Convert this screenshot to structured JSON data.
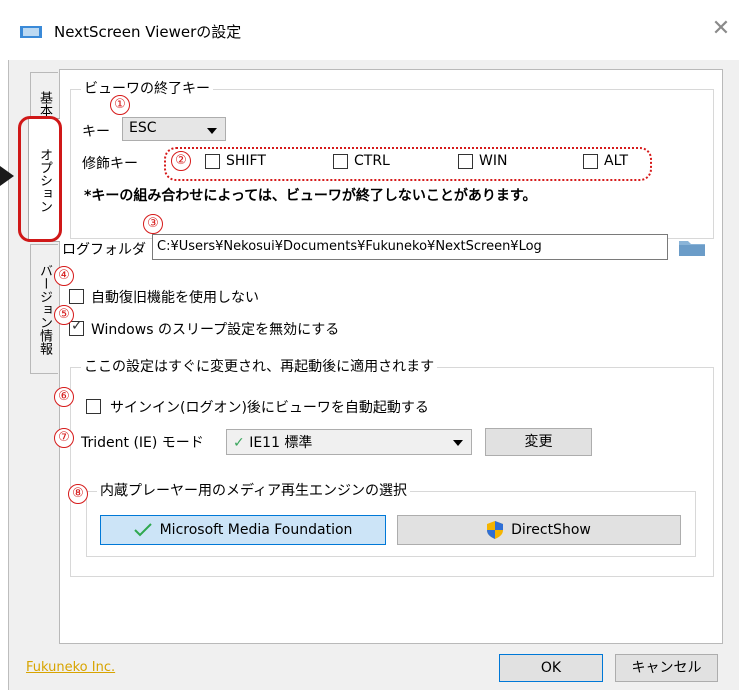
{
  "window": {
    "title": "NextScreen Viewerの設定",
    "close_glyph": "✕"
  },
  "tabs": [
    {
      "label": "基本"
    },
    {
      "label": "オプション"
    },
    {
      "label": "バージョン情報"
    }
  ],
  "markers": [
    "①",
    "②",
    "③",
    "④",
    "⑤",
    "⑥",
    "⑦",
    "⑧"
  ],
  "exit_key": {
    "legend": "ビューワの終了キー",
    "key_label": "キー",
    "key_value": "ESC",
    "modifier_label": "修飾キー",
    "modifiers": [
      {
        "label": "SHIFT",
        "checked": false
      },
      {
        "label": "CTRL",
        "checked": false
      },
      {
        "label": "WIN",
        "checked": false
      },
      {
        "label": "ALT",
        "checked": false
      }
    ],
    "warning": "*キーの組み合わせによっては、ビューワが終了しないことがあります。"
  },
  "log": {
    "label": "ログフォルダ",
    "path": "C:¥Users¥Nekosui¥Documents¥Fukuneko¥NextScreen¥Log"
  },
  "auto_recovery": {
    "label": "自動復旧機能を使用しない",
    "checked": false
  },
  "sleep": {
    "label": "Windows のスリープ設定を無効にする",
    "checked": true
  },
  "restart_group": {
    "legend": "ここの設定はすぐに変更され、再起動後に適用されます",
    "autostart": {
      "label": "サインイン(ログオン)後にビューワを自動起動する",
      "checked": false
    },
    "trident": {
      "label": "Trident (IE) モード",
      "check_glyph": "✓",
      "value": "IE11 標準",
      "change_button": "変更"
    },
    "engine": {
      "legend": "内蔵プレーヤー用のメディア再生エンジンの選択",
      "options": [
        {
          "label": "Microsoft Media Foundation",
          "selected": true,
          "icon": "checkmark-icon"
        },
        {
          "label": "DirectShow",
          "selected": false,
          "icon": "shield-icon"
        }
      ]
    }
  },
  "footer": {
    "company_link": "Fukuneko Inc.",
    "ok": "OK",
    "cancel": "キャンセル"
  },
  "colors": {
    "accent": "#0078d7",
    "marker": "#d61a1a",
    "link": "#d8a400",
    "selected_bg": "#cce4f7"
  }
}
